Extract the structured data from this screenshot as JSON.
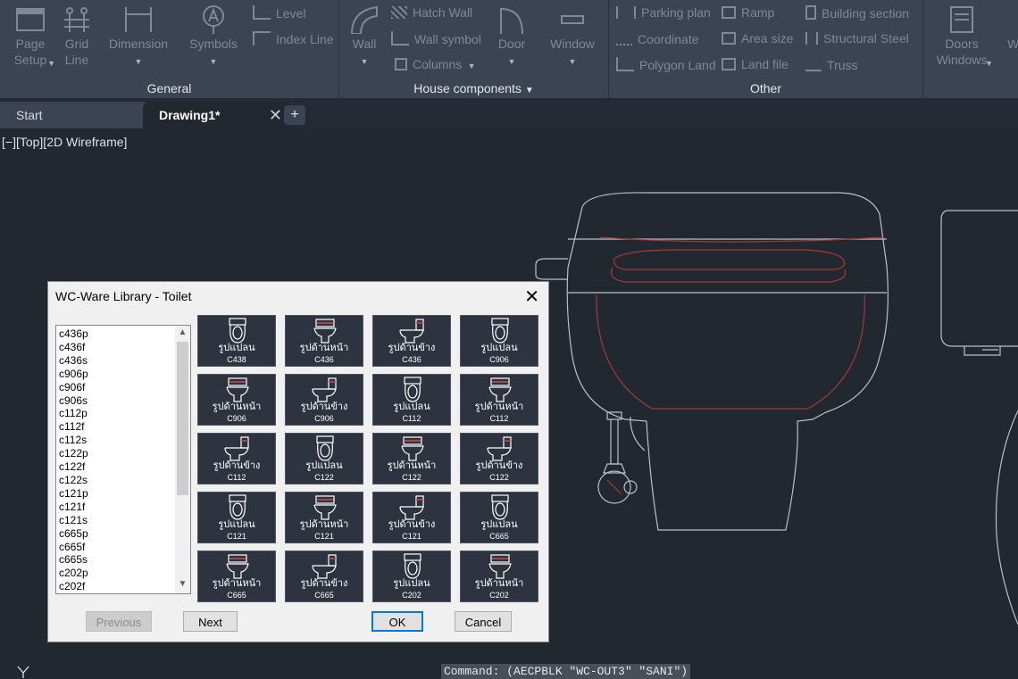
{
  "ribbon": {
    "general": {
      "title": "General",
      "page_setup": "Page\nSetup",
      "grid_line": "Grid\nLine",
      "dimension": "Dimension",
      "symbols": "Symbols",
      "level": "Level",
      "index_line": "Index Line"
    },
    "house": {
      "title": "House components",
      "wall": "Wall",
      "hatch_wall": "Hatch Wall",
      "wall_symbol": "Wall symbol",
      "columns": "Columns",
      "door": "Door",
      "window": "Window"
    },
    "other": {
      "title": "Other",
      "parking_plan": "Parking plan",
      "coordinate": "Coordinate",
      "polygon_land": "Polygon Land",
      "ramp": "Ramp",
      "area_size": "Area size",
      "land_file": "Land file",
      "building_section": "Building section",
      "structural_steel": "Structural Steel",
      "truss": "Truss"
    },
    "doors_windows": "Doors\nWindows",
    "cut_letter": "W"
  },
  "tabs": {
    "start": "Start",
    "drawing": "Drawing1*",
    "close": "✕",
    "add": "+"
  },
  "viewport_label": "[−][Top][2D Wireframe]",
  "command_line": "Command: (AECPBLK \"WC-OUT3\" \"SANI\")",
  "dialog": {
    "title": "WC-Ware Library - Toilet",
    "close": "✕",
    "list_items": [
      "c436p",
      "c436f",
      "c436s",
      "c906p",
      "c906f",
      "c906s",
      "c112p",
      "c112f",
      "c112s",
      "c122p",
      "c122f",
      "c122s",
      "c121p",
      "c121f",
      "c121s",
      "c665p",
      "c665f",
      "c665s",
      "c202p",
      "c202f"
    ],
    "tiles": [
      {
        "label": "รูปแปลน",
        "code": "C438",
        "kind": "plan"
      },
      {
        "label": "รูปด้านหน้า",
        "code": "C436",
        "kind": "front"
      },
      {
        "label": "รูปด้านข้าง",
        "code": "C436",
        "kind": "side"
      },
      {
        "label": "รูปแปลน",
        "code": "C906",
        "kind": "plan"
      },
      {
        "label": "รูปด้านหน้า",
        "code": "C906",
        "kind": "front"
      },
      {
        "label": "รูปด้านข้าง",
        "code": "C906",
        "kind": "side"
      },
      {
        "label": "รูปแปลน",
        "code": "C112",
        "kind": "plan"
      },
      {
        "label": "รูปด้านหน้า",
        "code": "C112",
        "kind": "front"
      },
      {
        "label": "รูปด้านข้าง",
        "code": "C112",
        "kind": "side"
      },
      {
        "label": "รูปแปลน",
        "code": "C122",
        "kind": "plan"
      },
      {
        "label": "รูปด้านหน้า",
        "code": "C122",
        "kind": "front"
      },
      {
        "label": "รูปด้านข้าง",
        "code": "C122",
        "kind": "side"
      },
      {
        "label": "รูปแปลน",
        "code": "C121",
        "kind": "plan"
      },
      {
        "label": "รูปด้านหน้า",
        "code": "C121",
        "kind": "front"
      },
      {
        "label": "รูปด้านข้าง",
        "code": "C121",
        "kind": "side"
      },
      {
        "label": "รูปแปลน",
        "code": "C665",
        "kind": "plan"
      },
      {
        "label": "รูปด้านหน้า",
        "code": "C665",
        "kind": "front"
      },
      {
        "label": "รูปด้านข้าง",
        "code": "C665",
        "kind": "side"
      },
      {
        "label": "รูปแปลน",
        "code": "C202",
        "kind": "plan"
      },
      {
        "label": "รูปด้านหน้า",
        "code": "C202",
        "kind": "front"
      }
    ],
    "buttons": {
      "previous": "Previous",
      "next": "Next",
      "ok": "OK",
      "cancel": "Cancel"
    }
  },
  "colors": {
    "ribbon_bg": "#3b4452",
    "canvas_bg": "#212830",
    "cad_line": "#b9c0c8",
    "cad_red": "#a33a3a",
    "dialog_bg": "#f0f0f0",
    "tile_bg": "#2d3440",
    "ok_border": "#0078d7"
  }
}
